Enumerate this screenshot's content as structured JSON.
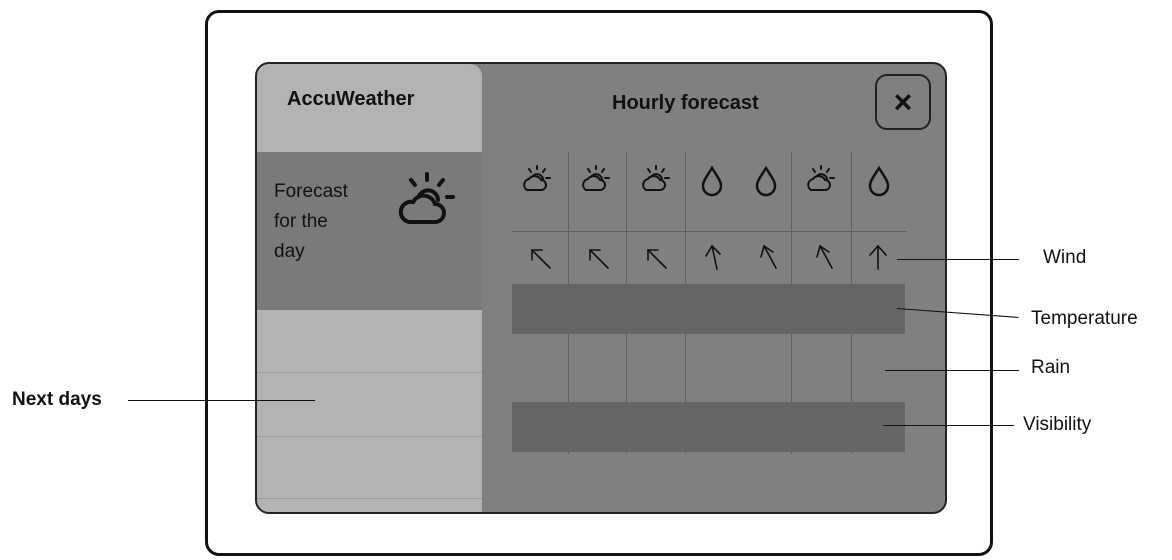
{
  "app": {
    "name": "AccuWeather"
  },
  "today": {
    "label_lines": [
      "Forecast",
      "for the",
      "day"
    ],
    "icon": "partly-cloudy-icon"
  },
  "hourly": {
    "title": "Hourly forecast",
    "close_label": "×",
    "conditions": [
      "partly-cloudy",
      "partly-cloudy",
      "partly-cloudy",
      "rain-drop",
      "rain-drop",
      "partly-cloudy",
      "rain-drop"
    ],
    "wind_directions": [
      "north-west",
      "north-west",
      "north-west",
      "north",
      "north-west",
      "north-west",
      "north"
    ]
  },
  "callouts": {
    "wind": "Wind",
    "temperature": "Temperature",
    "rain": "Rain",
    "visibility": "Visibility",
    "next_days": "Next days"
  },
  "colors": {
    "screen_bg": "#808080",
    "panel_light": "#b3b3b3",
    "band": "#666666"
  }
}
